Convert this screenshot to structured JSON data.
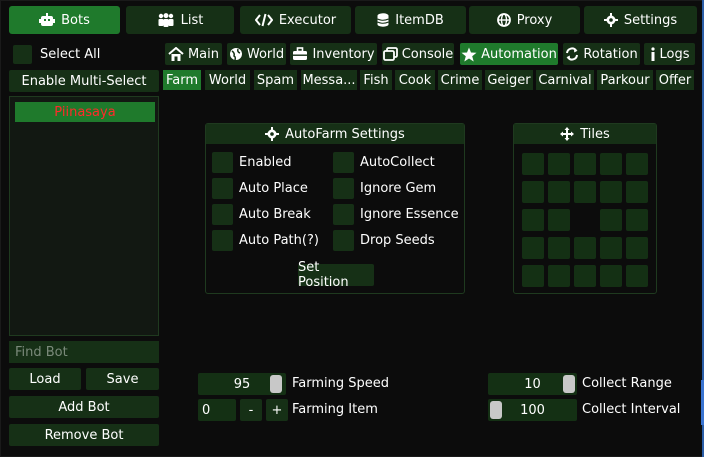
{
  "topnav": [
    {
      "label": "Bots",
      "icon": "robot-icon",
      "active": true
    },
    {
      "label": "List",
      "icon": "users-icon",
      "active": false
    },
    {
      "label": "Executor",
      "icon": "code-icon",
      "active": false
    },
    {
      "label": "ItemDB",
      "icon": "database-icon",
      "active": false
    },
    {
      "label": "Proxy",
      "icon": "globe-icon",
      "active": false
    },
    {
      "label": "Settings",
      "icon": "gear-icon",
      "active": false
    }
  ],
  "sidebar": {
    "select_all": "Select All",
    "enable_multi": "Enable Multi-Select",
    "bots": [
      "Piinasaya"
    ],
    "find_placeholder": "Find Bot",
    "load": "Load",
    "save": "Save",
    "add_bot": "Add Bot",
    "remove_bot": "Remove Bot"
  },
  "subtabs": [
    {
      "label": "Main",
      "icon": "home-icon",
      "active": false
    },
    {
      "label": "World",
      "icon": "globe-icon",
      "active": false
    },
    {
      "label": "Inventory",
      "icon": "briefcase-icon",
      "active": false
    },
    {
      "label": "Console",
      "icon": "console-icon",
      "active": false
    },
    {
      "label": "Automation",
      "icon": "star-icon",
      "active": true
    },
    {
      "label": "Rotation",
      "icon": "rotation-icon",
      "active": false
    },
    {
      "label": "Logs",
      "icon": "info-icon",
      "active": false
    }
  ],
  "farmtabs": [
    {
      "label": "Farm",
      "active": true
    },
    {
      "label": "World",
      "active": false
    },
    {
      "label": "Spam",
      "active": false
    },
    {
      "label": "Messa...",
      "active": false
    },
    {
      "label": "Fish",
      "active": false
    },
    {
      "label": "Cook",
      "active": false
    },
    {
      "label": "Crime",
      "active": false
    },
    {
      "label": "Geiger",
      "active": false
    },
    {
      "label": "Carnival",
      "active": false
    },
    {
      "label": "Parkour",
      "active": false
    },
    {
      "label": "Offer",
      "active": false
    }
  ],
  "autofarm": {
    "title": "AutoFarm Settings",
    "left": [
      "Enabled",
      "Auto Place",
      "Auto Break",
      "Auto Path(?)"
    ],
    "right": [
      "AutoCollect",
      "Ignore Gem",
      "Ignore Essence",
      "Drop Seeds"
    ],
    "set_position": "Set Position"
  },
  "tiles": {
    "title": "Tiles"
  },
  "controls": {
    "farming_speed": {
      "value": "95",
      "label": "Farming Speed"
    },
    "farming_item": {
      "value": "0",
      "minus": "-",
      "plus": "+",
      "label": "Farming Item"
    },
    "collect_range": {
      "value": "10",
      "label": "Collect Range"
    },
    "collect_interval": {
      "value": "100",
      "label": "Collect Interval"
    }
  },
  "colors": {
    "accent": "#1f7a2c",
    "dark_button": "#163016",
    "bot_name": "#ff2a2a"
  }
}
